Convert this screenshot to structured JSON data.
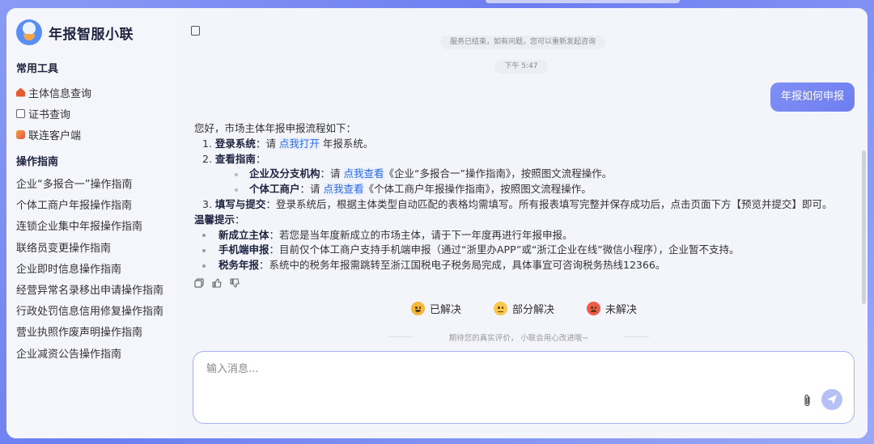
{
  "app": {
    "title": "年报智服小联"
  },
  "sidebar": {
    "tools_title": "常用工具",
    "tools": [
      {
        "label": "主体信息查询",
        "icon": "home-icon"
      },
      {
        "label": "证书查询",
        "icon": "certificate-icon"
      },
      {
        "label": "联连客户端",
        "icon": "app-icon"
      }
    ],
    "guides_title": "操作指南",
    "guides": [
      {
        "label": "企业“多报合一”操作指南"
      },
      {
        "label": "个体工商户年报操作指南"
      },
      {
        "label": "连锁企业集中年报操作指南"
      },
      {
        "label": "联络员变更操作指南"
      },
      {
        "label": "企业即时信息操作指南"
      },
      {
        "label": "经营异常名录移出申请操作指南"
      },
      {
        "label": "行政处罚信息信用修复操作指南"
      },
      {
        "label": "营业执照作废声明操作指南"
      },
      {
        "label": "企业减资公告操作指南"
      }
    ]
  },
  "chat": {
    "system_note": "服务已结束，如有问题，您可以重新发起咨询",
    "time": "下午 5:47",
    "user_message": "年报如何申报",
    "answer": {
      "intro": "您好，市场主体年报申报流程如下：",
      "step1_num": "1.",
      "step1_title": "登录系统",
      "step1_pre": "：请 ",
      "step1_link": "点我打开",
      "step1_post": " 年报系统。",
      "step2_num": "2.",
      "step2_title": "查看指南",
      "step2_colon": "：",
      "sub1_title": "企业及分支机构",
      "sub1_pre": "：请 ",
      "sub1_link": "点我查看",
      "sub1_post": "《企业“多报合一”操作指南》，按照图文流程操作。",
      "sub2_title": "个体工商户",
      "sub2_pre": "：请 ",
      "sub2_link": "点我查看",
      "sub2_post": "《个体工商户年报操作指南》，按照图文流程操作。",
      "step3_num": "3.",
      "step3_title": "填写与提交",
      "step3_text": "：登录系统后，根据主体类型自动匹配的表格均需填写。所有报表填写完整并保存成功后，点击页面下方【预览并提交】即可。",
      "tips_title": "温馨提示",
      "tips_colon": "：",
      "tip1_title": "新成立主体",
      "tip1_text": "：若您是当年度新成立的市场主体，请于下一年度再进行年报申报。",
      "tip2_title": "手机端申报",
      "tip2_text": "：目前仅个体工商户支持手机端申报（通过“浙里办APP”或“浙江企业在线”微信小程序），企业暂不支持。",
      "tip3_title": "税务年报",
      "tip3_text": "：系统中的税务年报需跳转至浙江国税电子税务局完成，具体事宜可咨询税务热线12366。"
    },
    "feedback": {
      "resolved": "已解决",
      "partial": "部分解决",
      "unresolved": "未解决",
      "hint": "期待您的真实评价， 小联会用心改进哦~"
    },
    "input": {
      "placeholder": "输入消息..."
    }
  },
  "colors": {
    "accent": "#6f7ef0",
    "link": "#2b6be6"
  }
}
